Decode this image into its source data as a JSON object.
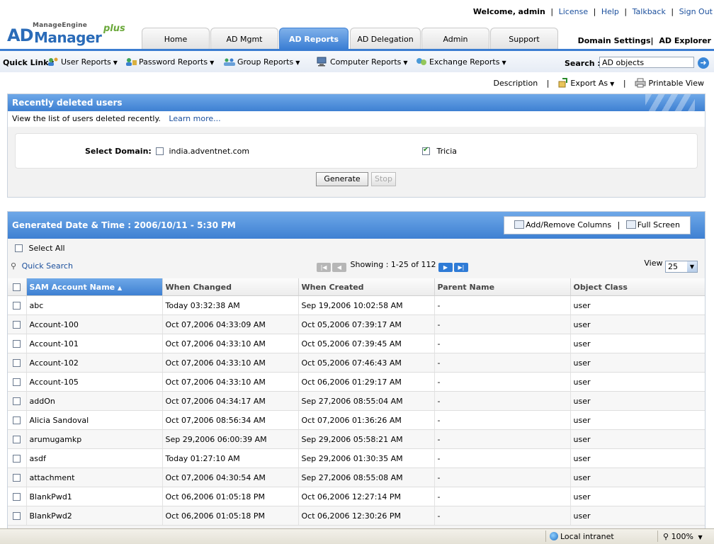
{
  "header": {
    "brand_small": "ManageEngine",
    "brand_ad": "AD",
    "brand_name": "Manager",
    "brand_plus": "plus",
    "welcome_label": "Welcome,",
    "user": "admin",
    "links": [
      "License",
      "Help",
      "Talkback",
      "Sign Out"
    ],
    "tabs": [
      {
        "label": "Home",
        "active": false
      },
      {
        "label": "AD Mgmt",
        "active": false
      },
      {
        "label": "AD Reports",
        "active": true
      },
      {
        "label": "AD Delegation",
        "active": false
      },
      {
        "label": "Admin",
        "active": false
      },
      {
        "label": "Support",
        "active": false
      }
    ],
    "domain_settings": "Domain Settings",
    "ad_explorer": "AD Explorer"
  },
  "quicklinks": {
    "label": "Quick Link :",
    "items": [
      "User Reports",
      "Password Reports",
      "Group Reports",
      "Computer Reports",
      "Exchange Reports"
    ],
    "search_label": "Search :",
    "search_value": "AD objects"
  },
  "actions": {
    "description": "Description",
    "export_as": "Export As",
    "printable": "Printable View"
  },
  "report": {
    "title": "Recently deleted users",
    "description": "View the list of users deleted recently.",
    "learn_more": "Learn more...",
    "select_domain_label": "Select Domain:",
    "domains": [
      {
        "name": "india.adventnet.com",
        "checked": false
      },
      {
        "name": "Tricia",
        "checked": true
      }
    ],
    "generate_label": "Generate",
    "stop_label": "Stop"
  },
  "results": {
    "generated_label": "Generated Date & Time : 2006/10/11 - 5:30 PM",
    "add_remove_columns": "Add/Remove Columns",
    "full_screen": "Full Screen",
    "select_all": "Select All",
    "quick_search": "Quick Search",
    "showing": "Showing : 1-25 of 112",
    "view_label": "View",
    "view_value": "25",
    "columns": [
      "SAM Account Name",
      "When Changed",
      "When Created",
      "Parent Name",
      "Object Class"
    ],
    "sorted_column": "SAM Account Name",
    "rows": [
      [
        "abc",
        "Today 03:32:38 AM",
        "Sep 19,2006 10:02:58 AM",
        "-",
        "user"
      ],
      [
        "Account-100",
        "Oct 07,2006 04:33:09 AM",
        "Oct 05,2006 07:39:17 AM",
        "-",
        "user"
      ],
      [
        "Account-101",
        "Oct 07,2006 04:33:10 AM",
        "Oct 05,2006 07:39:45 AM",
        "-",
        "user"
      ],
      [
        "Account-102",
        "Oct 07,2006 04:33:10 AM",
        "Oct 05,2006 07:46:43 AM",
        "-",
        "user"
      ],
      [
        "Account-105",
        "Oct 07,2006 04:33:10 AM",
        "Oct 06,2006 01:29:17 AM",
        "-",
        "user"
      ],
      [
        "addOn",
        "Oct 07,2006 04:34:17 AM",
        "Sep 27,2006 08:55:04 AM",
        "-",
        "user"
      ],
      [
        "Alicia Sandoval",
        "Oct 07,2006 08:56:34 AM",
        "Oct 07,2006 01:36:26 AM",
        "-",
        "user"
      ],
      [
        "arumugamkp",
        "Sep 29,2006 06:00:39 AM",
        "Sep 29,2006 05:58:21 AM",
        "-",
        "user"
      ],
      [
        "asdf",
        "Today 01:27:10 AM",
        "Sep 29,2006 01:30:35 AM",
        "-",
        "user"
      ],
      [
        "attachment",
        "Oct 07,2006 04:30:54 AM",
        "Sep 27,2006 08:55:08 AM",
        "-",
        "user"
      ],
      [
        "BlankPwd1",
        "Oct 06,2006 01:05:18 PM",
        "Oct 06,2006 12:27:14 PM",
        "-",
        "user"
      ],
      [
        "BlankPwd2",
        "Oct 06,2006 01:05:18 PM",
        "Oct 06,2006 12:30:26 PM",
        "-",
        "user"
      ]
    ]
  },
  "statusbar": {
    "zone": "Local intranet",
    "zoom": "100%"
  },
  "colors": {
    "accent": "#3e80d2",
    "accent_light": "#6ea8e8",
    "link": "#1b4f9c"
  }
}
